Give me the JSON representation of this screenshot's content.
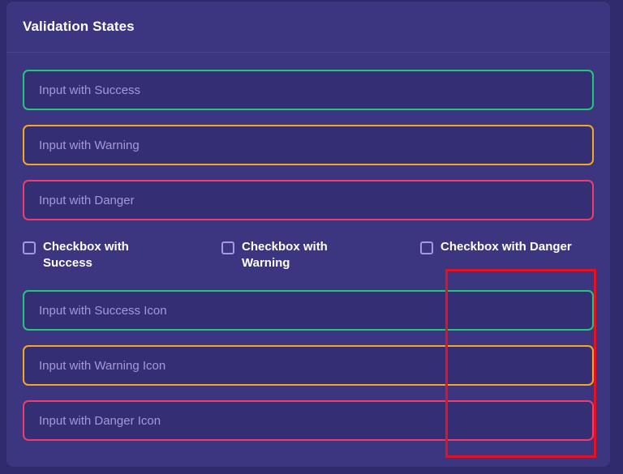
{
  "card": {
    "title": "Validation States"
  },
  "inputs": {
    "success": {
      "placeholder": "Input with Success"
    },
    "warning": {
      "placeholder": "Input with Warning"
    },
    "danger": {
      "placeholder": "Input with Danger"
    },
    "success_icon": {
      "placeholder": "Input with Success Icon"
    },
    "warning_icon": {
      "placeholder": "Input with Warning Icon"
    },
    "danger_icon": {
      "placeholder": "Input with Danger Icon"
    }
  },
  "checkboxes": {
    "success": {
      "label_line1": "Checkbox with",
      "label_line2": "Success"
    },
    "warning": {
      "label_line1": "Checkbox with",
      "label_line2": "Warning"
    },
    "danger": {
      "label": "Checkbox with Danger"
    }
  },
  "colors": {
    "success": "#22c87a",
    "warning": "#f5a623",
    "danger": "#ec3d6f",
    "card_bg": "#3c3580",
    "page_bg": "#2f2a6b",
    "highlight": "#e01224"
  }
}
